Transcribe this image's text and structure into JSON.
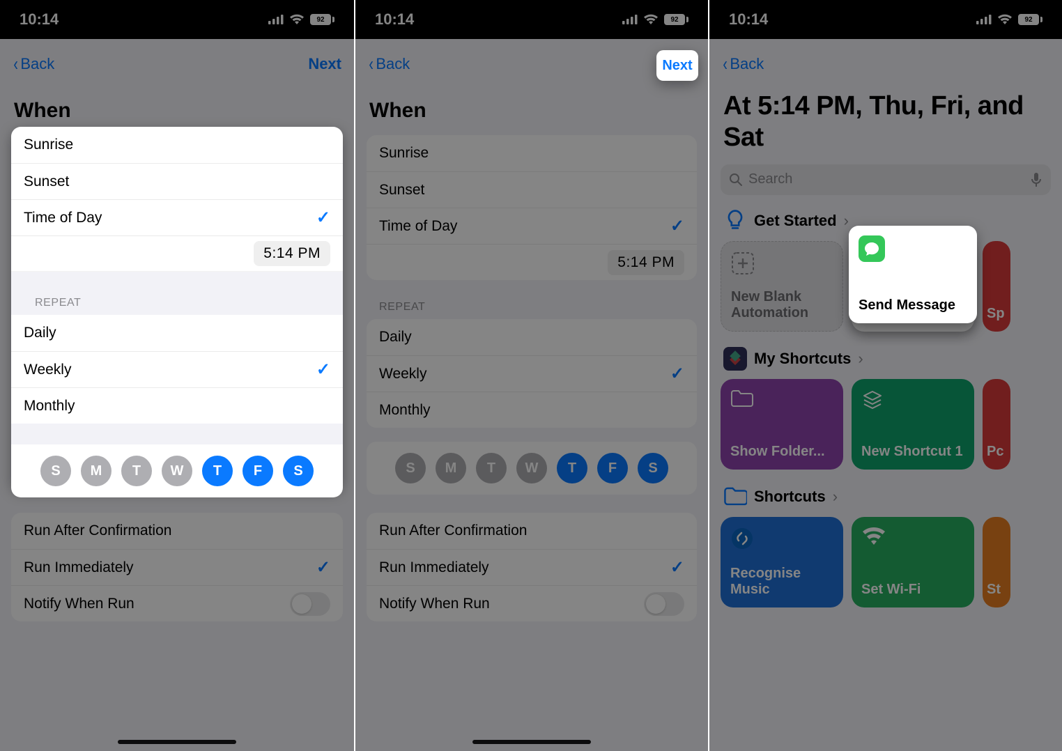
{
  "status": {
    "time": "10:14",
    "battery": "92"
  },
  "nav": {
    "back": "Back",
    "next": "Next"
  },
  "panel1": {
    "title": "When",
    "when_options": [
      "Sunrise",
      "Sunset",
      "Time of Day"
    ],
    "when_selected": 2,
    "time": "5:14 PM",
    "repeat_label": "REPEAT",
    "repeat_options": [
      "Daily",
      "Weekly",
      "Monthly"
    ],
    "repeat_selected": 1,
    "days": [
      "S",
      "M",
      "T",
      "W",
      "T",
      "F",
      "S"
    ],
    "days_selected": [
      false,
      false,
      false,
      false,
      true,
      true,
      true
    ],
    "run_options": {
      "confirm": "Run After Confirmation",
      "immediate": "Run Immediately",
      "notify": "Notify When Run"
    }
  },
  "panel3": {
    "title": "At 5:14 PM, Thu, Fri, and Sat",
    "search_placeholder": "Search",
    "get_started": "Get Started",
    "new_blank": "New Blank Automation",
    "send_message": "Send Message",
    "sp_partial": "Sp",
    "my_shortcuts": "My Shortcuts",
    "show_folder": "Show Folder...",
    "new_shortcut": "New Shortcut 1",
    "pc_partial": "Pc",
    "shortcuts": "Shortcuts",
    "recognise": "Recognise Music",
    "wifi": "Set Wi-Fi",
    "st_partial": "St"
  }
}
